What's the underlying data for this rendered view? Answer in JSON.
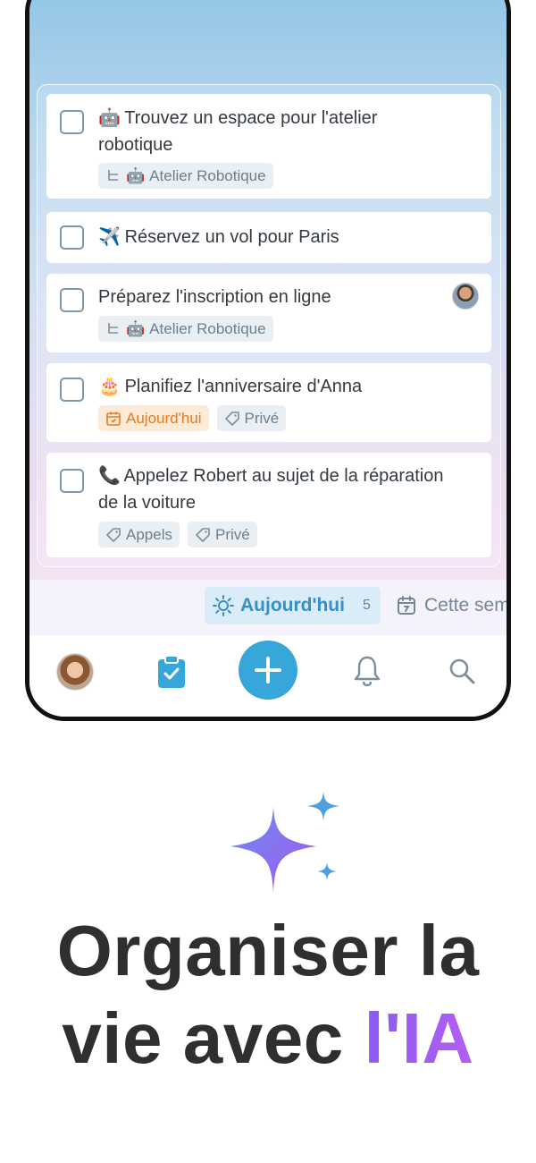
{
  "tasks": [
    {
      "emoji": "🤖",
      "title": "Trouvez un espace pour l'atelier robotique",
      "project_emoji": "🤖",
      "project": "Atelier Robotique"
    },
    {
      "emoji": "✈️",
      "title": "Réservez un vol pour Paris"
    },
    {
      "title": "Préparez l'inscription en ligne",
      "project_emoji": "🤖",
      "project": "Atelier Robotique"
    },
    {
      "emoji": "🎂",
      "title": "Planifiez l'anniversaire d'Anna",
      "date_tag": "Aujourd'hui",
      "label_tag": "Privé"
    },
    {
      "emoji": "📞",
      "title": "Appelez Robert au sujet de la réparation de la voiture",
      "tags": [
        "Appels",
        "Privé"
      ]
    }
  ],
  "filters": {
    "today_label": "Aujourd'hui",
    "today_count": "5",
    "week_label": "Cette semaine"
  },
  "headline": {
    "line1": "Organiser la",
    "line2_prefix": "vie avec ",
    "line2_highlight": "l'IA"
  },
  "colors": {
    "accent": "#37a6d9",
    "today_tag": "#e7791f",
    "ai_gradient_start": "#8a5cf0",
    "ai_gradient_end": "#b45ef2"
  }
}
